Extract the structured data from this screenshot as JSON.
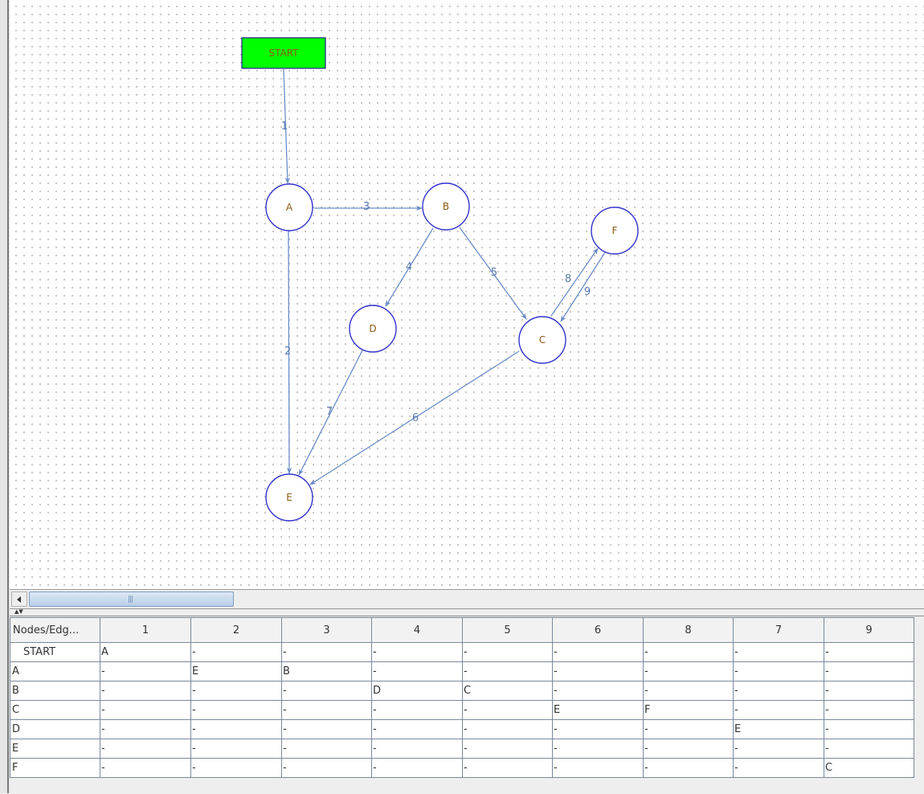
{
  "graph": {
    "start_label": "START",
    "colors": {
      "start_fill": "#00ff00",
      "start_border": "#1f1f8f",
      "node_border": "#3333cc",
      "node_text": "#8a5a10",
      "edge": "#6a8cc8",
      "edge_label": "#5a7ab0"
    },
    "nodes": [
      {
        "id": "A",
        "label": "A"
      },
      {
        "id": "B",
        "label": "B"
      },
      {
        "id": "C",
        "label": "C"
      },
      {
        "id": "D",
        "label": "D"
      },
      {
        "id": "E",
        "label": "E"
      },
      {
        "id": "F",
        "label": "F"
      }
    ],
    "edges": [
      {
        "label": "1",
        "from": "START",
        "to": "A"
      },
      {
        "label": "2",
        "from": "A",
        "to": "E"
      },
      {
        "label": "3",
        "from": "A",
        "to": "B"
      },
      {
        "label": "4",
        "from": "B",
        "to": "D"
      },
      {
        "label": "5",
        "from": "B",
        "to": "C"
      },
      {
        "label": "6",
        "from": "C",
        "to": "E"
      },
      {
        "label": "7",
        "from": "D",
        "to": "E"
      },
      {
        "label": "8",
        "from": "C",
        "to": "F"
      },
      {
        "label": "9",
        "from": "F",
        "to": "C"
      }
    ]
  },
  "table": {
    "columns": [
      "Nodes/Edg...",
      "1",
      "2",
      "3",
      "4",
      "5",
      "6",
      "8",
      "7",
      "9"
    ],
    "rows": [
      [
        "START",
        "A",
        "-",
        "-",
        "-",
        "-",
        "-",
        "-",
        "-",
        "-"
      ],
      [
        "A",
        "-",
        "E",
        "B",
        "-",
        "-",
        "-",
        "-",
        "-",
        "-"
      ],
      [
        "B",
        "-",
        "-",
        "-",
        "D",
        "C",
        "-",
        "-",
        "-",
        "-"
      ],
      [
        "C",
        "-",
        "-",
        "-",
        "-",
        "-",
        "E",
        "F",
        "-",
        "-"
      ],
      [
        "D",
        "-",
        "-",
        "-",
        "-",
        "-",
        "-",
        "-",
        "E",
        "-"
      ],
      [
        "E",
        "-",
        "-",
        "-",
        "-",
        "-",
        "-",
        "-",
        "-",
        "-"
      ],
      [
        "F",
        "-",
        "-",
        "-",
        "-",
        "-",
        "-",
        "-",
        "-",
        "C"
      ]
    ]
  }
}
